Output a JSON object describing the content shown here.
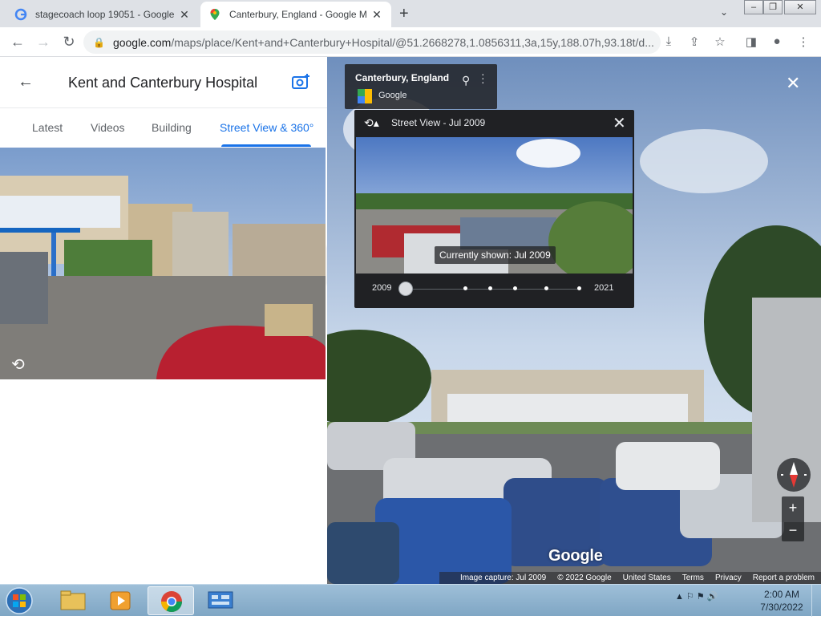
{
  "browser": {
    "tabs": [
      {
        "title": "stagecoach loop 19051 - Google",
        "active": false,
        "icon": "google-g-icon"
      },
      {
        "title": "Canterbury, England - Google M",
        "active": true,
        "icon": "google-maps-pin-icon"
      }
    ],
    "new_tab": "+",
    "url_domain": "google.com",
    "url_path": "/maps/place/Kent+and+Canterbury+Hospital/@51.2668278,1.0856311,3a,15y,188.07h,93.18t/d..."
  },
  "left_panel": {
    "title": "Kent and Canterbury Hospital",
    "tabs": [
      {
        "label": "Latest",
        "active": false
      },
      {
        "label": "Videos",
        "active": false
      },
      {
        "label": "Building",
        "active": false
      },
      {
        "label": "Street View & 360°",
        "active": true
      }
    ]
  },
  "street_view": {
    "place": "Canterbury, England",
    "source": "Google",
    "time_machine": {
      "label": "Street View - Jul 2009",
      "currently_shown": "Currently shown: Jul 2009",
      "start_year": "2009",
      "end_year": "2021"
    },
    "logo": "Google",
    "footer": [
      "Image capture: Jul 2009",
      "© 2022 Google",
      "United States",
      "Terms",
      "Privacy",
      "Report a problem"
    ],
    "zoom_in": "+",
    "zoom_out": "−"
  },
  "taskbar": {
    "time": "2:00 AM",
    "date": "7/30/2022"
  },
  "colors": {
    "accent": "#1a73e8",
    "overlay": "#202124",
    "taskbar": "#8fb3cf"
  }
}
